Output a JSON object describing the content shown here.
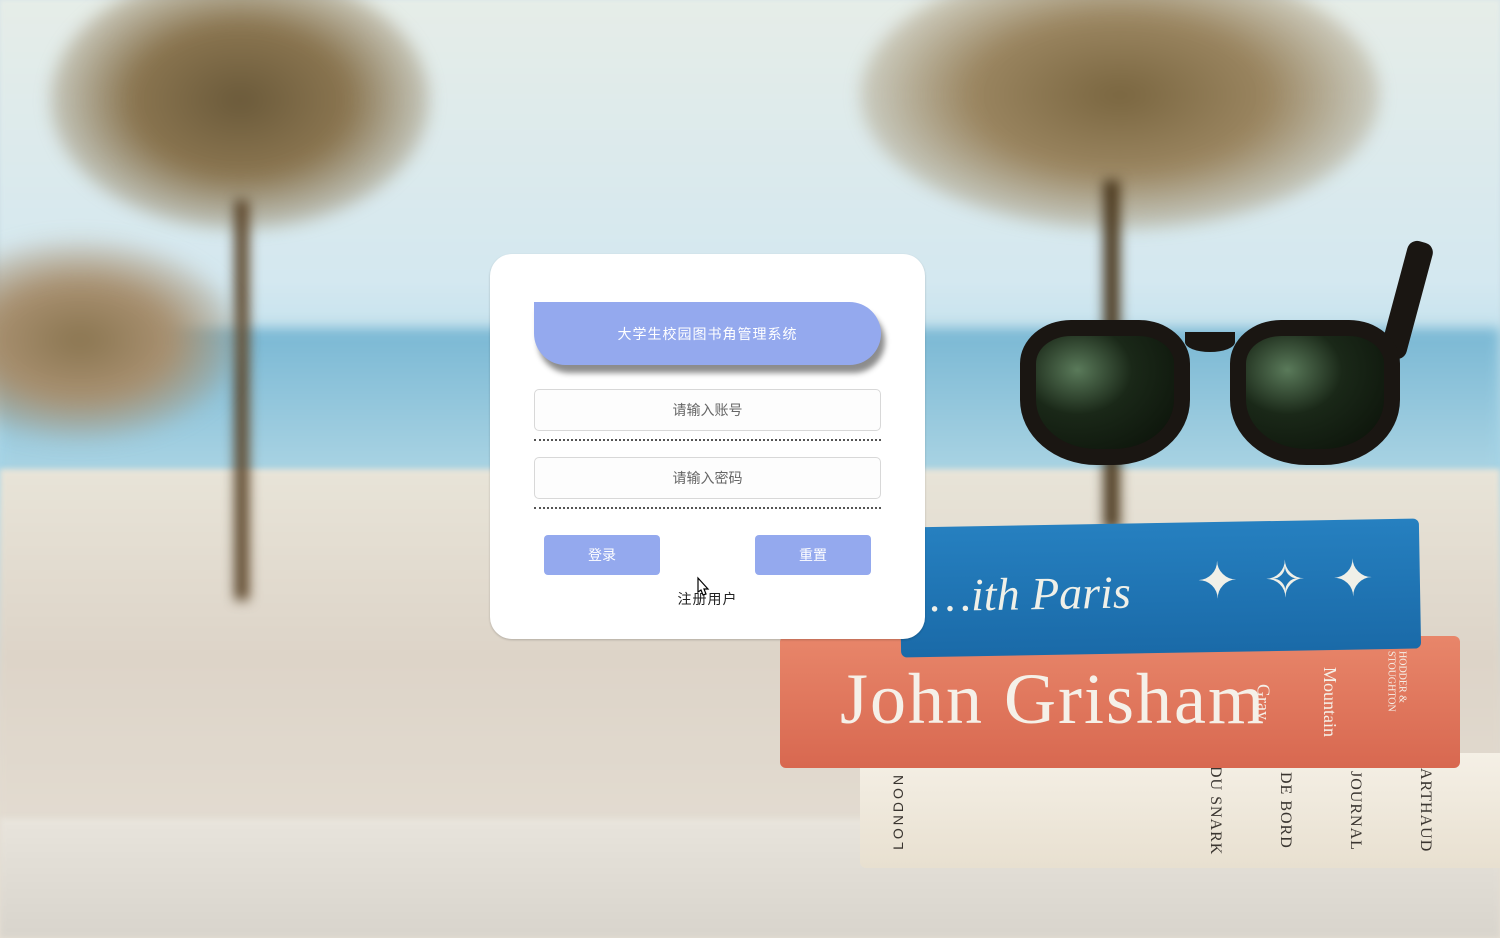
{
  "login": {
    "title": "大学生校园图书角管理系统",
    "username_placeholder": "请输入账号",
    "password_placeholder": "请输入密码",
    "username_value": "",
    "password_value": "",
    "login_button": "登录",
    "reset_button": "重置",
    "register_link": "注册用户"
  },
  "colors": {
    "accent": "#94a9ee",
    "card_bg": "#ffffff",
    "text_dark": "#222222"
  },
  "background_decor": {
    "book1_text": "…ith Paris",
    "book2_text": "John Grisham",
    "book2_side_a": "Gray",
    "book2_side_b": "Mountain",
    "book2_side_c": "HODDER & STOUGHTON",
    "book3_side_a": "DU SNARK",
    "book3_side_b": "DE BORD",
    "book3_side_c": "JOURNAL",
    "book3_side_d": "ARTHAUD",
    "book3_left": "LONDON"
  }
}
